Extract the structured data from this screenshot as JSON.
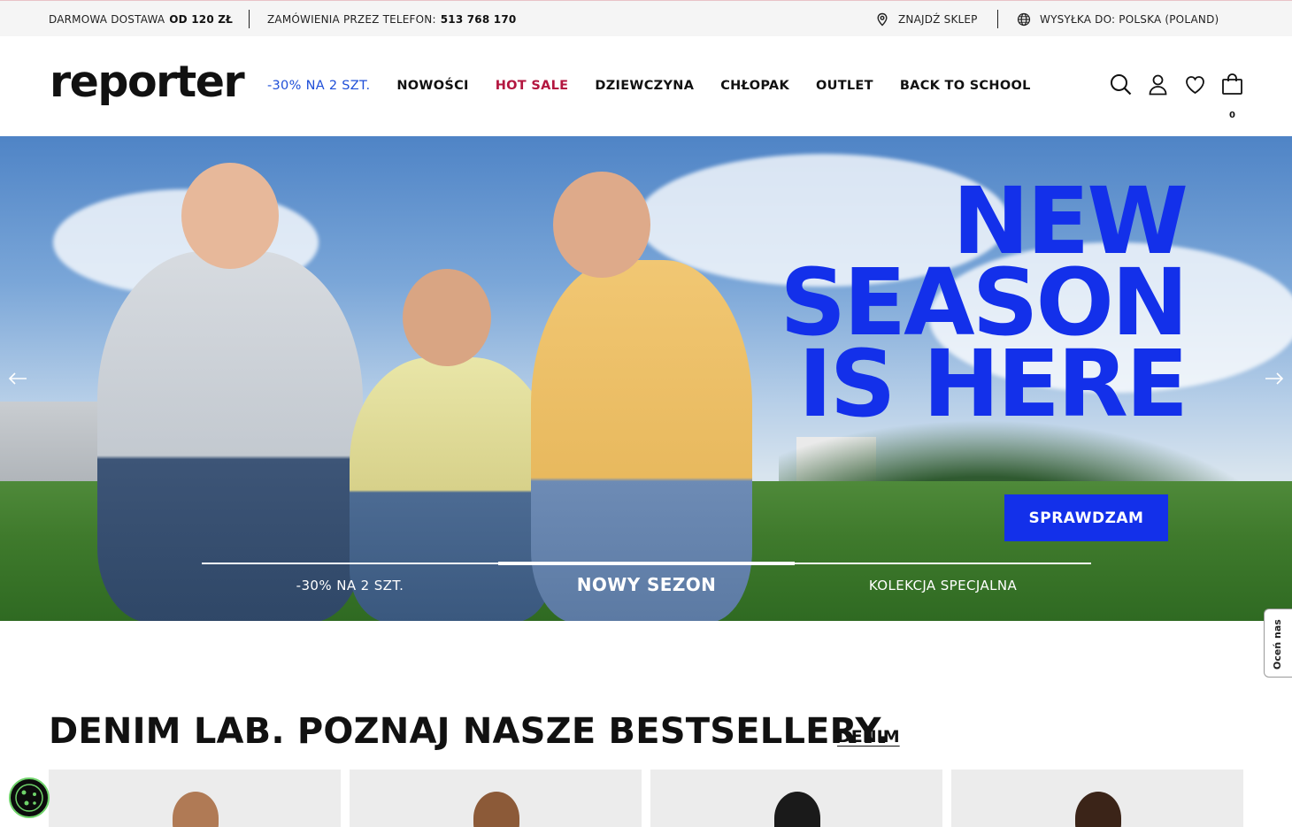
{
  "topbar": {
    "shipping_text": "DARMOWA DOSTAWA",
    "shipping_threshold": "OD 120 ZŁ",
    "phone_text": "ZAMÓWIENIA PRZEZ TELEFON:",
    "phone_number": "513 768 170",
    "find_store": "ZNAJDŹ SKLEP",
    "ship_to": "WYSYŁKA DO: POLSKA (POLAND)"
  },
  "header": {
    "logo": "reporter",
    "nav": [
      {
        "label": "-30% NA 2 SZT."
      },
      {
        "label": "NOWOŚCI"
      },
      {
        "label": "HOT SALE"
      },
      {
        "label": "DZIEWCZYNA"
      },
      {
        "label": "CHŁOPAK"
      },
      {
        "label": "OUTLET"
      },
      {
        "label": "BACK TO SCHOOL"
      }
    ],
    "icons": [
      "search-icon",
      "account-icon",
      "wishlist-icon",
      "cart-icon"
    ],
    "cart_count": "0"
  },
  "hero": {
    "title_lines": [
      "NEW",
      "SEASON",
      "IS HERE"
    ],
    "cta": "SPRAWDZAM",
    "accent_color": "#1330ea",
    "slides": [
      {
        "label": "-30% NA 2 SZT."
      },
      {
        "label": "NOWY SEZON"
      },
      {
        "label": "KOLEKCJA SPECJALNA"
      }
    ],
    "active_slide": 1
  },
  "feedback": {
    "label": "Oceń nas"
  },
  "section": {
    "title": "DENIM LAB. POZNAJ NASZE BESTSELLERY.",
    "link": "DENIM"
  }
}
